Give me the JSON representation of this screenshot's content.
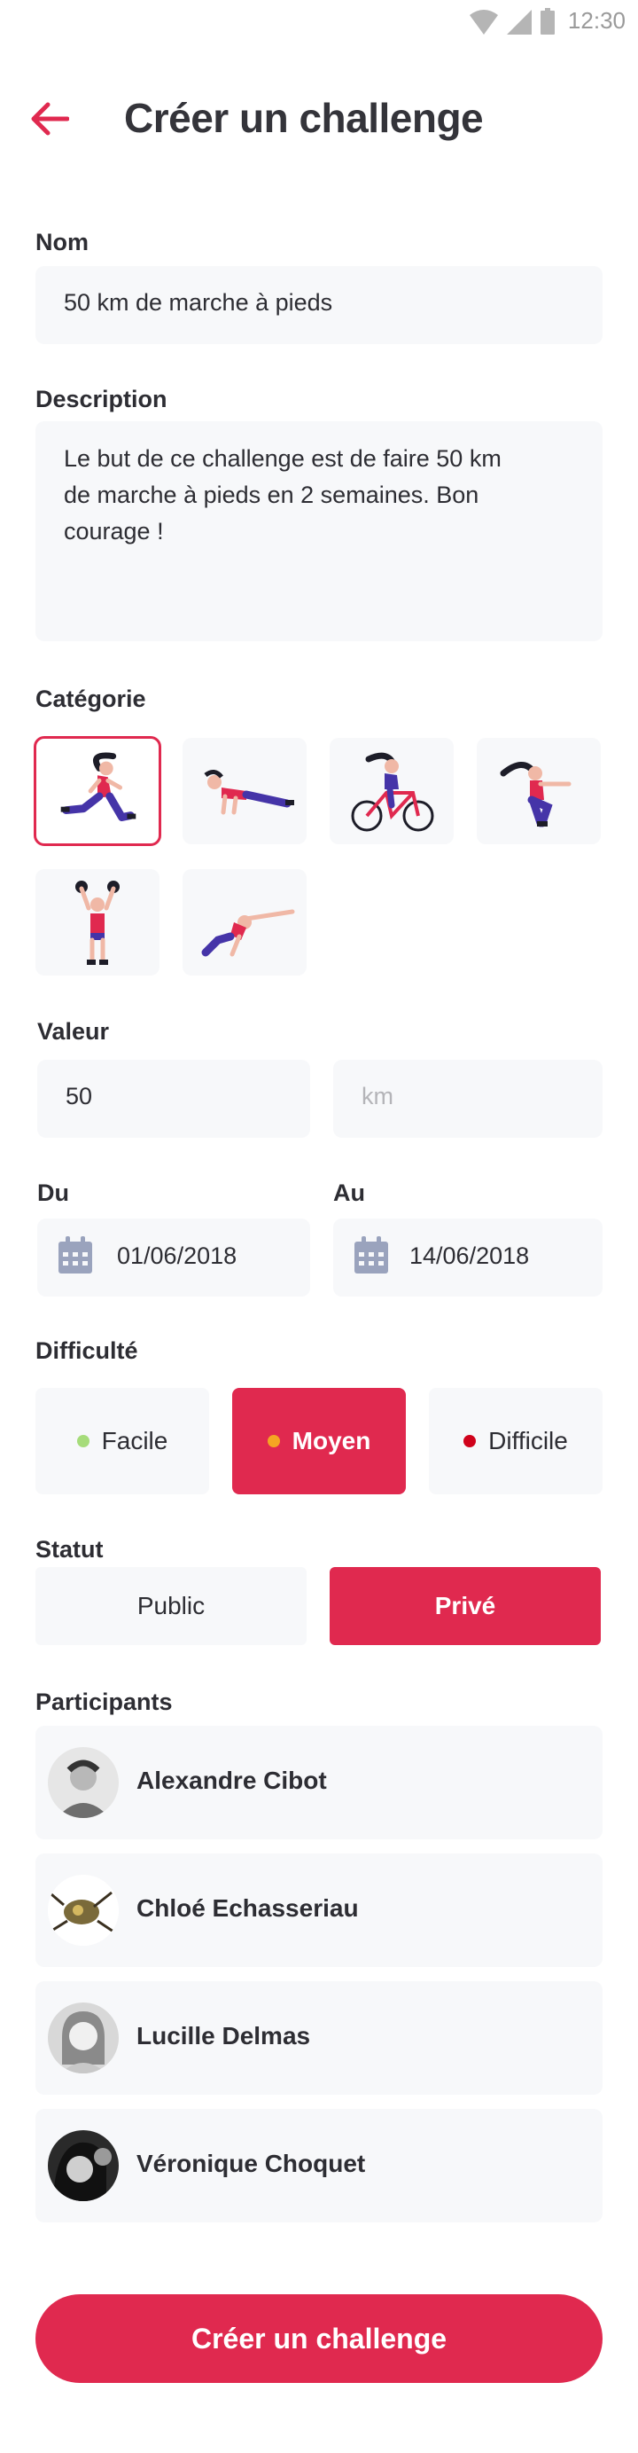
{
  "status_bar": {
    "time": "12:30"
  },
  "header": {
    "title": "Créer un challenge"
  },
  "form": {
    "name_label": "Nom",
    "name_value": "50 km de marche à pieds",
    "description_label": "Description",
    "description_lines": [
      "Le but de ce challenge est de faire 50 km",
      "de marche à pieds en 2 semaines. Bon",
      "courage !"
    ],
    "category_label": "Catégorie",
    "categories": [
      {
        "icon": "running-icon",
        "selected": true
      },
      {
        "icon": "pushup-icon",
        "selected": false
      },
      {
        "icon": "cycling-icon",
        "selected": false
      },
      {
        "icon": "squat-icon",
        "selected": false
      },
      {
        "icon": "weightlifting-icon",
        "selected": false
      },
      {
        "icon": "plank-icon",
        "selected": false
      }
    ],
    "value_label": "Valeur",
    "value": "50",
    "unit_placeholder": "km",
    "from_label": "Du",
    "from_date": "01/06/2018",
    "to_label": "Au",
    "to_date": "14/06/2018",
    "difficulty_label": "Difficulté",
    "difficulty": [
      {
        "label": "Facile",
        "color": "#a6dc7a",
        "active": false
      },
      {
        "label": "Moyen",
        "color": "#f5a623",
        "active": true
      },
      {
        "label": "Difficile",
        "color": "#d0021b",
        "active": false
      }
    ],
    "status_label": "Statut",
    "status": [
      {
        "label": "Public",
        "active": false
      },
      {
        "label": "Privé",
        "active": true
      }
    ],
    "participants_label": "Participants",
    "participants": [
      {
        "name": "Alexandre Cibot"
      },
      {
        "name": "Chloé Echasseriau"
      },
      {
        "name": "Lucille Delmas"
      },
      {
        "name": "Véronique Choquet"
      }
    ],
    "submit_label": "Créer un challenge"
  },
  "colors": {
    "accent": "#e0294f",
    "field_bg": "#f7f8fa",
    "text": "#2d2d33"
  }
}
